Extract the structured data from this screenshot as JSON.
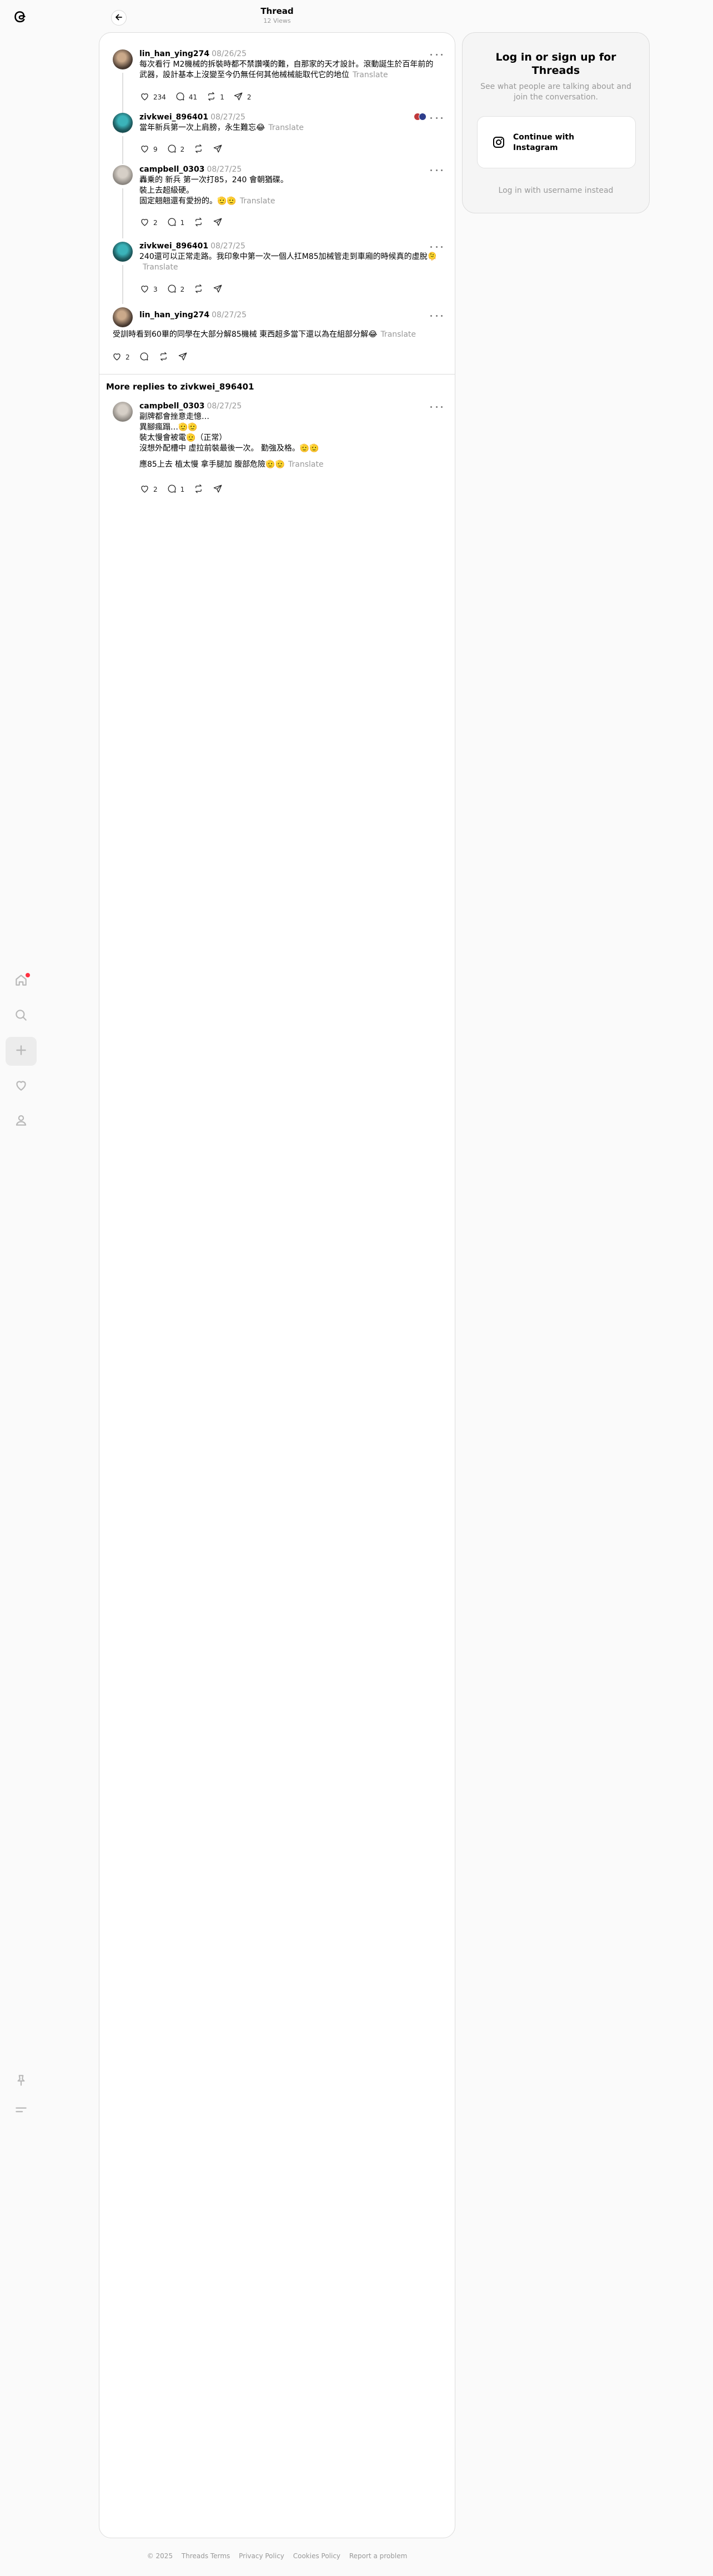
{
  "header": {
    "title": "Thread",
    "views": "12 Views"
  },
  "posts": [
    {
      "username": "lin_han_ying274",
      "date": "08/26/25",
      "text": "每次看行 M2機械的拆裝時都不禁讚嘆的難，自那家的天才設計。滾動誕生於百年前的武器，設計基本上沒變至今仍無任何其他械械能取代它的地位",
      "translate": "Translate",
      "likes": "234",
      "replies": "41",
      "reposts": "1",
      "shares": "2"
    },
    {
      "username": "zivkwei_896401",
      "date": "08/27/25",
      "text": "當年新兵第一次上肩膀，永生難忘😂",
      "translate": "Translate",
      "likes": "9",
      "replies": "2",
      "reposts": "",
      "shares": ""
    },
    {
      "username": "campbell_0303",
      "date": "08/27/25",
      "text": "轟乗的 新兵 第一次打85，240 會朝猶碟。\n裝上去超級硬。\n固定翹翹還有愛扮的。🫡🫡",
      "translate": "Translate",
      "likes": "2",
      "replies": "1",
      "reposts": "",
      "shares": ""
    },
    {
      "username": "zivkwei_896401",
      "date": "08/27/25",
      "text": "240還可以正常走路。我印象中第一次一個人扛M85加械管走到車廂的時候真的虛脫🫠",
      "translate": "Translate",
      "likes": "3",
      "replies": "2",
      "reposts": "",
      "shares": ""
    },
    {
      "username": "lin_han_ying274",
      "date": "08/27/25",
      "text": "受訓時看到60畢的同學在大部分解85機械 東西超多當下還以為在組部分解😂",
      "translate": "Translate",
      "likes": "2",
      "replies": "",
      "reposts": "",
      "shares": ""
    }
  ],
  "more_replies": {
    "title": "More replies to zivkwei_896401",
    "post": {
      "username": "campbell_0303",
      "date": "08/27/25",
      "text": "副牌都會挫意走憶…\n異腳瘋蹋…🫡🫡\n裝太慢會被電🫡（正常）\n沒想外配槽中 虛拉前裝最後一次。 勤強及格。🫡🫡",
      "text2": "應85上去 植太慢 拿手腿加 腹部危險🫡🫡",
      "translate": "Translate",
      "likes": "2",
      "replies": "1",
      "reposts": "",
      "shares": ""
    }
  },
  "login": {
    "title": "Log in or sign up for Threads",
    "subtitle": "See what people are talking about and join the conversation.",
    "instagram_button": "Continue with Instagram",
    "alt_link": "Log in with username instead"
  },
  "footer": [
    "© 2025",
    "Threads Terms",
    "Privacy Policy",
    "Cookies Policy",
    "Report a problem"
  ],
  "colors": {
    "accent_badge": "#ff3040",
    "muted_text": "#999999",
    "border": "#dcdcdc"
  },
  "icons": [
    "threads-logo-icon",
    "home-icon",
    "search-icon",
    "plus-icon",
    "heart-icon",
    "profile-icon",
    "pin-icon",
    "menu-icon",
    "back-arrow-icon",
    "like-icon",
    "reply-icon",
    "repost-icon",
    "share-icon",
    "more-icon",
    "instagram-icon"
  ]
}
